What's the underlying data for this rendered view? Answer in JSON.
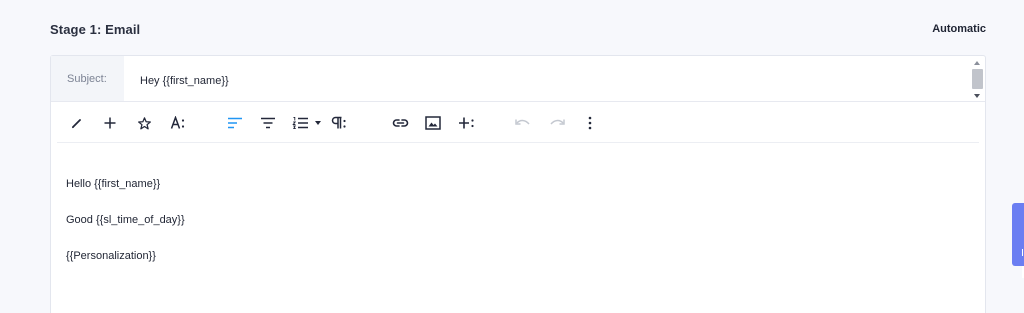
{
  "stage": {
    "title": "Stage 1: Email",
    "mode": "Automatic"
  },
  "subject": {
    "label": "Subject:",
    "value": "Hey {{first_name}}"
  },
  "toolbar": {
    "icons": [
      "brush-icon",
      "plus-icon",
      "star-icon",
      "text-format-icon",
      "align-left-icon",
      "align-center-icon",
      "ordered-list-icon",
      "dropdown-caret-icon",
      "paragraph-format-icon",
      "link-icon",
      "image-icon",
      "insert-more-icon",
      "undo-icon",
      "redo-icon",
      "more-vertical-icon"
    ],
    "active_color": "#2196f3",
    "disabled_color": "#c4c8d0"
  },
  "body": {
    "paragraphs": [
      "Hello {{first_name}}",
      "Good {{sl_time_of_day}}",
      "{{Personalization}}"
    ]
  },
  "side_tab": {
    "color": "#6b7ef2"
  }
}
